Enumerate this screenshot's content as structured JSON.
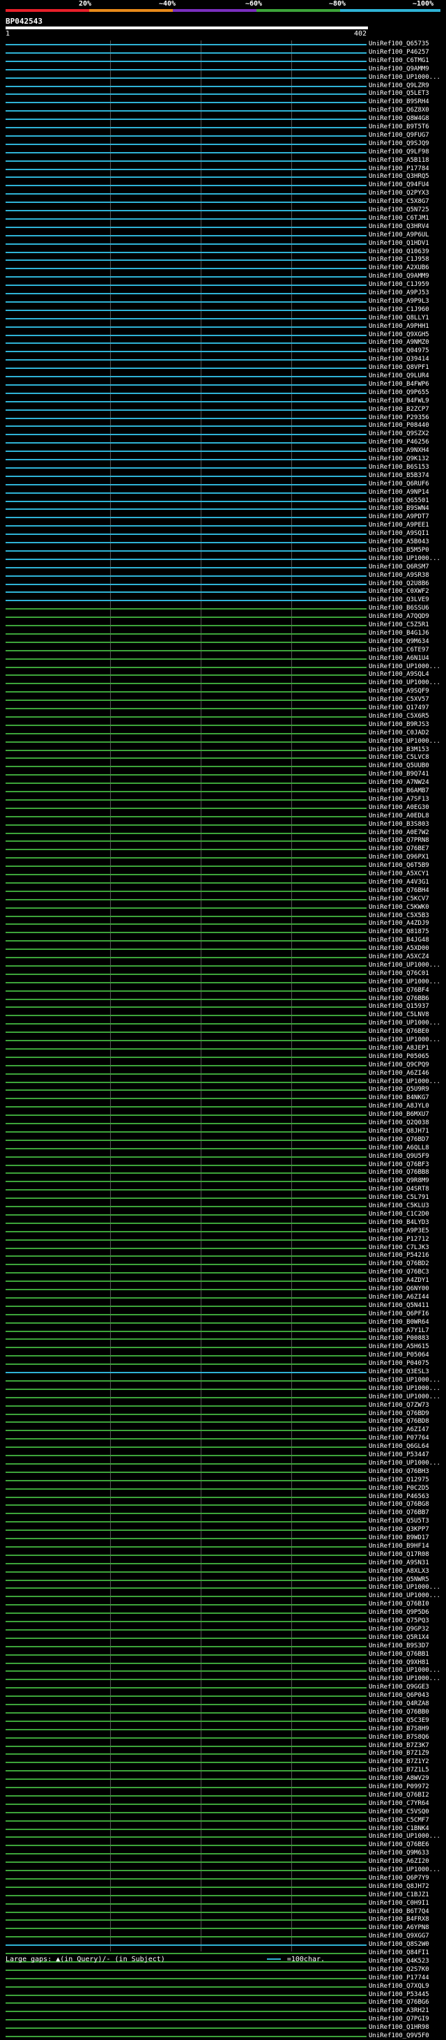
{
  "legend": {
    "ticks": [
      "20%",
      "~40%",
      "~60%",
      "~80%",
      "~100%"
    ],
    "colors": [
      "#e8202a",
      "#e88a1a",
      "#7b2fbf",
      "#3da43a",
      "#2fb3d6"
    ]
  },
  "query": {
    "id": "BP042543",
    "start": "1",
    "end": "402"
  },
  "footer": {
    "gaps_text": "Large gaps: ▲(in Query)/- (in Subject)",
    "scale_text": "=100char."
  },
  "hits": [
    {
      "label": "UniRef100_Q65735",
      "color": "#2fb3d6"
    },
    {
      "label": "UniRef100_P46257",
      "color": "#2fb3d6"
    },
    {
      "label": "UniRef100_C6TMG1",
      "color": "#2fb3d6"
    },
    {
      "label": "UniRef100_Q9AMM9",
      "color": "#2fb3d6"
    },
    {
      "label": "UniRef100_UP1000...",
      "color": "#2fb3d6"
    },
    {
      "label": "UniRef100_Q9LZR9",
      "color": "#2fb3d6"
    },
    {
      "label": "UniRef100_Q5LET3",
      "color": "#2fb3d6"
    },
    {
      "label": "UniRef100_B9SRH4",
      "color": "#2fb3d6"
    },
    {
      "label": "UniRef100_Q6Z8X0",
      "color": "#2fb3d6"
    },
    {
      "label": "UniRef100_Q8W4G8",
      "color": "#2fb3d6"
    },
    {
      "label": "UniRef100_B9T5T6",
      "color": "#2fb3d6"
    },
    {
      "label": "UniRef100_Q9FUG7",
      "color": "#2fb3d6"
    },
    {
      "label": "UniRef100_Q9SJQ9",
      "color": "#2fb3d6"
    },
    {
      "label": "UniRef100_Q9LF98",
      "color": "#2fb3d6"
    },
    {
      "label": "UniRef100_A5B118",
      "color": "#2fb3d6"
    },
    {
      "label": "UniRef100_P17784",
      "color": "#2fb3d6"
    },
    {
      "label": "UniRef100_Q3HRQ5",
      "color": "#2fb3d6"
    },
    {
      "label": "UniRef100_Q94FU4",
      "color": "#2fb3d6"
    },
    {
      "label": "UniRef100_Q2PYX3",
      "color": "#2fb3d6"
    },
    {
      "label": "UniRef100_C5X8G7",
      "color": "#2fb3d6"
    },
    {
      "label": "UniRef100_Q5N725",
      "color": "#2fb3d6"
    },
    {
      "label": "UniRef100_C6TJM1",
      "color": "#2fb3d6"
    },
    {
      "label": "UniRef100_Q3HRV4",
      "color": "#2fb3d6"
    },
    {
      "label": "UniRef100_A9P6UL",
      "color": "#2fb3d6"
    },
    {
      "label": "UniRef100_Q1HDV1",
      "color": "#2fb3d6"
    },
    {
      "label": "UniRef100_Q10639",
      "color": "#2fb3d6"
    },
    {
      "label": "UniRef100_C1J958",
      "color": "#2fb3d6"
    },
    {
      "label": "UniRef100_A2XUB6",
      "color": "#2fb3d6"
    },
    {
      "label": "UniRef100_Q9AMM9",
      "color": "#2fb3d6"
    },
    {
      "label": "UniRef100_C1J959",
      "color": "#2fb3d6"
    },
    {
      "label": "UniRef100_A9PJ53",
      "color": "#2fb3d6"
    },
    {
      "label": "UniRef100_A9P9L3",
      "color": "#2fb3d6"
    },
    {
      "label": "UniRef100_C1J960",
      "color": "#2fb3d6"
    },
    {
      "label": "UniRef100_Q8LLY1",
      "color": "#2fb3d6"
    },
    {
      "label": "UniRef100_A9PHH1",
      "color": "#2fb3d6"
    },
    {
      "label": "UniRef100_Q9XGH5",
      "color": "#2fb3d6"
    },
    {
      "label": "UniRef100_A9NMZ0",
      "color": "#2fb3d6"
    },
    {
      "label": "UniRef100_Q04975",
      "color": "#2fb3d6"
    },
    {
      "label": "UniRef100_Q39414",
      "color": "#2fb3d6"
    },
    {
      "label": "UniRef100_Q8VPF1",
      "color": "#2fb3d6"
    },
    {
      "label": "UniRef100_Q9LUR4",
      "color": "#2fb3d6"
    },
    {
      "label": "UniRef100_B4FWP6",
      "color": "#2fb3d6"
    },
    {
      "label": "UniRef100_Q9P655",
      "color": "#2fb3d6"
    },
    {
      "label": "UniRef100_B4FWL9",
      "color": "#2fb3d6"
    },
    {
      "label": "UniRef100_B2ZCP7",
      "color": "#2fb3d6"
    },
    {
      "label": "UniRef100_P29356",
      "color": "#2fb3d6"
    },
    {
      "label": "UniRef100_P08440",
      "color": "#2fb3d6"
    },
    {
      "label": "UniRef100_Q9SZX2",
      "color": "#2fb3d6"
    },
    {
      "label": "UniRef100_P46256",
      "color": "#2fb3d6"
    },
    {
      "label": "UniRef100_A9NXH4",
      "color": "#2fb3d6"
    },
    {
      "label": "UniRef100_Q9K132",
      "color": "#2fb3d6"
    },
    {
      "label": "UniRef100_B6S153",
      "color": "#2fb3d6"
    },
    {
      "label": "UniRef100_B5B374",
      "color": "#2fb3d6"
    },
    {
      "label": "UniRef100_Q6RUF6",
      "color": "#2fb3d6"
    },
    {
      "label": "UniRef100_A9NP14",
      "color": "#2fb3d6"
    },
    {
      "label": "UniRef100_Q65501",
      "color": "#2fb3d6"
    },
    {
      "label": "UniRef100_B9SWN4",
      "color": "#2fb3d6"
    },
    {
      "label": "UniRef100_A9PDT7",
      "color": "#2fb3d6"
    },
    {
      "label": "UniRef100_A9PEE1",
      "color": "#2fb3d6"
    },
    {
      "label": "UniRef100_A9SQI1",
      "color": "#2fb3d6"
    },
    {
      "label": "UniRef100_A5B043",
      "color": "#2fb3d6"
    },
    {
      "label": "UniRef100_B5M5P0",
      "color": "#2fb3d6"
    },
    {
      "label": "UniRef100_UP1000...",
      "color": "#2fb3d6"
    },
    {
      "label": "UniRef100_Q6RSM7",
      "color": "#2fb3d6"
    },
    {
      "label": "UniRef100_A9SR38",
      "color": "#2fb3d6"
    },
    {
      "label": "UniRef100_Q2U8B6",
      "color": "#2fb3d6"
    },
    {
      "label": "UniRef100_C0XWF2",
      "color": "#2fb3d6"
    },
    {
      "label": "UniRef100_Q3LVE9",
      "color": "#2fb3d6"
    },
    {
      "label": "UniRef100_B6SSU6",
      "color": "#3da43a"
    },
    {
      "label": "UniRef100_A7QQD9",
      "color": "#3da43a"
    },
    {
      "label": "UniRef100_C5Z5R1",
      "color": "#3da43a"
    },
    {
      "label": "UniRef100_B4G1J6",
      "color": "#3da43a"
    },
    {
      "label": "UniRef100_Q9M634",
      "color": "#3da43a"
    },
    {
      "label": "UniRef100_C6TE97",
      "color": "#3da43a"
    },
    {
      "label": "UniRef100_A6N1U4",
      "color": "#3da43a"
    },
    {
      "label": "UniRef100_UP1000...",
      "color": "#3da43a"
    },
    {
      "label": "UniRef100_A9SQL4",
      "color": "#3da43a"
    },
    {
      "label": "UniRef100_UP1000...",
      "color": "#3da43a"
    },
    {
      "label": "UniRef100_A9SQF9",
      "color": "#3da43a"
    },
    {
      "label": "UniRef100_C5XV57",
      "color": "#3da43a"
    },
    {
      "label": "UniRef100_Q17497",
      "color": "#3da43a"
    },
    {
      "label": "UniRef100_C5X6R5",
      "color": "#3da43a"
    },
    {
      "label": "UniRef100_B9RJS3",
      "color": "#3da43a"
    },
    {
      "label": "UniRef100_C0JAD2",
      "color": "#3da43a"
    },
    {
      "label": "UniRef100_UP1000...",
      "color": "#3da43a"
    },
    {
      "label": "UniRef100_B3M153",
      "color": "#3da43a"
    },
    {
      "label": "UniRef100_C5LVC8",
      "color": "#3da43a"
    },
    {
      "label": "UniRef100_Q5UUB0",
      "color": "#3da43a"
    },
    {
      "label": "UniRef100_B9Q741",
      "color": "#3da43a"
    },
    {
      "label": "UniRef100_A7NW24",
      "color": "#3da43a"
    },
    {
      "label": "UniRef100_B6AMB7",
      "color": "#3da43a"
    },
    {
      "label": "UniRef100_A7SF13",
      "color": "#3da43a"
    },
    {
      "label": "UniRef100_A0EG30",
      "color": "#3da43a"
    },
    {
      "label": "UniRef100_A0EDL8",
      "color": "#3da43a"
    },
    {
      "label": "UniRef100_B3S803",
      "color": "#3da43a"
    },
    {
      "label": "UniRef100_A0E7W2",
      "color": "#3da43a"
    },
    {
      "label": "UniRef100_Q7PRN8",
      "color": "#3da43a"
    },
    {
      "label": "UniRef100_Q76BE7",
      "color": "#3da43a"
    },
    {
      "label": "UniRef100_Q96PX1",
      "color": "#3da43a"
    },
    {
      "label": "UniRef100_Q6T5B9",
      "color": "#3da43a"
    },
    {
      "label": "UniRef100_A5XCY1",
      "color": "#3da43a"
    },
    {
      "label": "UniRef100_A4V3G1",
      "color": "#3da43a"
    },
    {
      "label": "UniRef100_Q76BH4",
      "color": "#3da43a"
    },
    {
      "label": "UniRef100_C5KCV7",
      "color": "#3da43a"
    },
    {
      "label": "UniRef100_C5KWK0",
      "color": "#3da43a"
    },
    {
      "label": "UniRef100_C5X5B3",
      "color": "#3da43a"
    },
    {
      "label": "UniRef100_A4ZDJ9",
      "color": "#3da43a"
    },
    {
      "label": "UniRef100_Q81875",
      "color": "#3da43a"
    },
    {
      "label": "UniRef100_B4JG48",
      "color": "#3da43a"
    },
    {
      "label": "UniRef100_A5XD00",
      "color": "#3da43a"
    },
    {
      "label": "UniRef100_A5XCZ4",
      "color": "#3da43a"
    },
    {
      "label": "UniRef100_UP1000...",
      "color": "#3da43a"
    },
    {
      "label": "UniRef100_Q76C01",
      "color": "#3da43a"
    },
    {
      "label": "UniRef100_UP1000...",
      "color": "#3da43a"
    },
    {
      "label": "UniRef100_Q76BF4",
      "color": "#3da43a"
    },
    {
      "label": "UniRef100_Q76BB6",
      "color": "#3da43a"
    },
    {
      "label": "UniRef100_Q15937",
      "color": "#3da43a"
    },
    {
      "label": "UniRef100_C5LNV8",
      "color": "#3da43a"
    },
    {
      "label": "UniRef100_UP1000...",
      "color": "#3da43a"
    },
    {
      "label": "UniRef100_Q76BE0",
      "color": "#3da43a"
    },
    {
      "label": "UniRef100_UP1000...",
      "color": "#3da43a"
    },
    {
      "label": "UniRef100_A8JEP1",
      "color": "#3da43a"
    },
    {
      "label": "UniRef100_P05065",
      "color": "#3da43a"
    },
    {
      "label": "UniRef100_Q9CPQ9",
      "color": "#3da43a"
    },
    {
      "label": "UniRef100_A6ZI46",
      "color": "#3da43a"
    },
    {
      "label": "UniRef100_UP1000...",
      "color": "#3da43a"
    },
    {
      "label": "UniRef100_Q5U9R9",
      "color": "#3da43a"
    },
    {
      "label": "UniRef100_B4NKG7",
      "color": "#3da43a"
    },
    {
      "label": "UniRef100_A8JYL0",
      "color": "#3da43a"
    },
    {
      "label": "UniRef100_B6MXU7",
      "color": "#3da43a"
    },
    {
      "label": "UniRef100_Q2Q038",
      "color": "#3da43a"
    },
    {
      "label": "UniRef100_Q8JH71",
      "color": "#3da43a"
    },
    {
      "label": "UniRef100_Q76BD7",
      "color": "#3da43a"
    },
    {
      "label": "UniRef100_A6QLL8",
      "color": "#3da43a"
    },
    {
      "label": "UniRef100_Q9U5F9",
      "color": "#3da43a"
    },
    {
      "label": "UniRef100_Q76BF3",
      "color": "#3da43a"
    },
    {
      "label": "UniRef100_Q76BB8",
      "color": "#3da43a"
    },
    {
      "label": "UniRef100_Q9R8M9",
      "color": "#3da43a"
    },
    {
      "label": "UniRef100_Q4SRT8",
      "color": "#3da43a"
    },
    {
      "label": "UniRef100_C5L791",
      "color": "#3da43a"
    },
    {
      "label": "UniRef100_C5KLU3",
      "color": "#3da43a"
    },
    {
      "label": "UniRef100_C1C2D0",
      "color": "#3da43a"
    },
    {
      "label": "UniRef100_B4LYD3",
      "color": "#3da43a"
    },
    {
      "label": "UniRef100_A9P3E5",
      "color": "#3da43a"
    },
    {
      "label": "UniRef100_P12712",
      "color": "#3da43a"
    },
    {
      "label": "UniRef100_C7LJK3",
      "color": "#3da43a"
    },
    {
      "label": "UniRef100_P54216",
      "color": "#3da43a"
    },
    {
      "label": "UniRef100_Q76BD2",
      "color": "#3da43a"
    },
    {
      "label": "UniRef100_Q76BC3",
      "color": "#3da43a"
    },
    {
      "label": "UniRef100_A4ZDY1",
      "color": "#3da43a"
    },
    {
      "label": "UniRef100_Q6NY00",
      "color": "#3da43a"
    },
    {
      "label": "UniRef100_A6ZI44",
      "color": "#3da43a"
    },
    {
      "label": "UniRef100_Q5N411",
      "color": "#3da43a"
    },
    {
      "label": "UniRef100_Q6PFI6",
      "color": "#3da43a"
    },
    {
      "label": "UniRef100_B0WR64",
      "color": "#3da43a"
    },
    {
      "label": "UniRef100_A7Y1L7",
      "color": "#3da43a"
    },
    {
      "label": "UniRef100_P00883",
      "color": "#3da43a"
    },
    {
      "label": "UniRef100_A5H615",
      "color": "#3da43a"
    },
    {
      "label": "UniRef100_P05064",
      "color": "#3da43a"
    },
    {
      "label": "UniRef100_P04075",
      "color": "#3da43a"
    },
    {
      "label": "UniRef100_Q3ESL3",
      "color": "#2fb3d6"
    },
    {
      "label": "UniRef100_UP1000...",
      "color": "#3da43a"
    },
    {
      "label": "UniRef100_UP1000...",
      "color": "#3da43a"
    },
    {
      "label": "UniRef100_UP1000...",
      "color": "#3da43a"
    },
    {
      "label": "UniRef100_Q7ZW73",
      "color": "#3da43a"
    },
    {
      "label": "UniRef100_Q76BD9",
      "color": "#3da43a"
    },
    {
      "label": "UniRef100_Q76BD8",
      "color": "#3da43a"
    },
    {
      "label": "UniRef100_A6ZI47",
      "color": "#3da43a"
    },
    {
      "label": "UniRef100_P07764",
      "color": "#3da43a"
    },
    {
      "label": "UniRef100_Q6GL64",
      "color": "#3da43a"
    },
    {
      "label": "UniRef100_P53447",
      "color": "#3da43a"
    },
    {
      "label": "UniRef100_UP1000...",
      "color": "#3da43a"
    },
    {
      "label": "UniRef100_Q76BH3",
      "color": "#3da43a"
    },
    {
      "label": "UniRef100_Q12975",
      "color": "#3da43a"
    },
    {
      "label": "UniRef100_P0C2D5",
      "color": "#3da43a"
    },
    {
      "label": "UniRef100_P46563",
      "color": "#3da43a"
    },
    {
      "label": "UniRef100_Q76BG8",
      "color": "#3da43a"
    },
    {
      "label": "UniRef100_Q76BB7",
      "color": "#3da43a"
    },
    {
      "label": "UniRef100_Q5U5T3",
      "color": "#3da43a"
    },
    {
      "label": "UniRef100_Q3KPP7",
      "color": "#3da43a"
    },
    {
      "label": "UniRef100_B9WD17",
      "color": "#3da43a"
    },
    {
      "label": "UniRef100_B9HF14",
      "color": "#3da43a"
    },
    {
      "label": "UniRef100_Q17R08",
      "color": "#3da43a"
    },
    {
      "label": "UniRef100_A9SN31",
      "color": "#3da43a"
    },
    {
      "label": "UniRef100_A8XLX3",
      "color": "#3da43a"
    },
    {
      "label": "UniRef100_Q5NWR5",
      "color": "#3da43a"
    },
    {
      "label": "UniRef100_UP1000...",
      "color": "#3da43a"
    },
    {
      "label": "UniRef100_UP1000...",
      "color": "#3da43a"
    },
    {
      "label": "UniRef100_Q76BI0",
      "color": "#3da43a"
    },
    {
      "label": "UniRef100_Q9P5D6",
      "color": "#3da43a"
    },
    {
      "label": "UniRef100_Q75PQ3",
      "color": "#3da43a"
    },
    {
      "label": "UniRef100_Q9GP32",
      "color": "#3da43a"
    },
    {
      "label": "UniRef100_Q5R1X4",
      "color": "#3da43a"
    },
    {
      "label": "UniRef100_B9S3D7",
      "color": "#3da43a"
    },
    {
      "label": "UniRef100_Q76BB1",
      "color": "#3da43a"
    },
    {
      "label": "UniRef100_Q9XH81",
      "color": "#3da43a"
    },
    {
      "label": "UniRef100_UP1000...",
      "color": "#3da43a"
    },
    {
      "label": "UniRef100_UP1000...",
      "color": "#3da43a"
    },
    {
      "label": "UniRef100_Q9GGE3",
      "color": "#3da43a"
    },
    {
      "label": "UniRef100_Q6P043",
      "color": "#3da43a"
    },
    {
      "label": "UniRef100_Q4RZA8",
      "color": "#3da43a"
    },
    {
      "label": "UniRef100_Q76BB0",
      "color": "#3da43a"
    },
    {
      "label": "UniRef100_Q5C3E9",
      "color": "#3da43a"
    },
    {
      "label": "UniRef100_B7S8H9",
      "color": "#3da43a"
    },
    {
      "label": "UniRef100_B7S8Q6",
      "color": "#3da43a"
    },
    {
      "label": "UniRef100_B7Z3K7",
      "color": "#3da43a"
    },
    {
      "label": "UniRef100_B7Z1Z9",
      "color": "#3da43a"
    },
    {
      "label": "UniRef100_B7Z1Y2",
      "color": "#3da43a"
    },
    {
      "label": "UniRef100_B7Z1L5",
      "color": "#3da43a"
    },
    {
      "label": "UniRef100_A8WV29",
      "color": "#3da43a"
    },
    {
      "label": "UniRef100_P09972",
      "color": "#3da43a"
    },
    {
      "label": "UniRef100_Q76BI2",
      "color": "#3da43a"
    },
    {
      "label": "UniRef100_C7YR64",
      "color": "#3da43a"
    },
    {
      "label": "UniRef100_C5VSQ0",
      "color": "#3da43a"
    },
    {
      "label": "UniRef100_C5CMF7",
      "color": "#3da43a"
    },
    {
      "label": "UniRef100_C1BNK4",
      "color": "#3da43a"
    },
    {
      "label": "UniRef100_UP1000...",
      "color": "#3da43a"
    },
    {
      "label": "UniRef100_Q76BE6",
      "color": "#3da43a"
    },
    {
      "label": "UniRef100_Q9M633",
      "color": "#3da43a"
    },
    {
      "label": "UniRef100_A6ZI20",
      "color": "#3da43a"
    },
    {
      "label": "UniRef100_UP1000...",
      "color": "#3da43a"
    },
    {
      "label": "UniRef100_Q6P7Y9",
      "color": "#3da43a"
    },
    {
      "label": "UniRef100_Q8JH72",
      "color": "#3da43a"
    },
    {
      "label": "UniRef100_C1BJZ1",
      "color": "#3da43a"
    },
    {
      "label": "UniRef100_C0H9I1",
      "color": "#3da43a"
    },
    {
      "label": "UniRef100_B6T7Q4",
      "color": "#3da43a"
    },
    {
      "label": "UniRef100_B4FRX8",
      "color": "#3da43a"
    },
    {
      "label": "UniRef100_A6YPN8",
      "color": "#3da43a"
    },
    {
      "label": "UniRef100_Q9XGG7",
      "color": "#3da43a"
    },
    {
      "label": "UniRef100_Q8S2W0",
      "color": "#2fb3d6"
    },
    {
      "label": "UniRef100_Q84FI1",
      "color": "#3da43a"
    },
    {
      "label": "UniRef100_Q4K523",
      "color": "#3da43a"
    },
    {
      "label": "UniRef100_Q2S7K0",
      "color": "#3da43a"
    },
    {
      "label": "UniRef100_P17744",
      "color": "#3da43a"
    },
    {
      "label": "UniRef100_Q7XQL9",
      "color": "#3da43a"
    },
    {
      "label": "UniRef100_P53445",
      "color": "#3da43a"
    },
    {
      "label": "UniRef100_Q76BG6",
      "color": "#3da43a"
    },
    {
      "label": "UniRef100_A3RH21",
      "color": "#3da43a"
    },
    {
      "label": "UniRef100_Q7PGI9",
      "color": "#3da43a"
    },
    {
      "label": "UniRef100_Q1HR98",
      "color": "#3da43a"
    },
    {
      "label": "UniRef100_Q9V5F0",
      "color": "#3da43a"
    }
  ]
}
